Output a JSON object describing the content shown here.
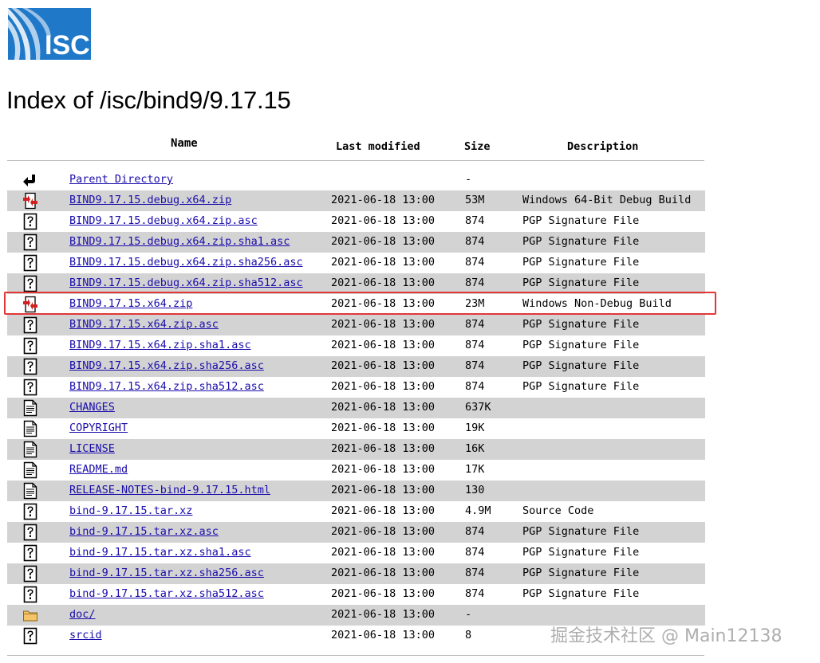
{
  "logo_text": "ISC",
  "page_title": "Index of /isc/bind9/9.17.15",
  "columns": {
    "name": "Name",
    "last_modified": "Last modified",
    "size": "Size",
    "description": "Description"
  },
  "rows": [
    {
      "icon": "back-icon",
      "name": "Parent Directory",
      "modified": "",
      "size": "-",
      "description": ""
    },
    {
      "icon": "binary-icon",
      "name": "BIND9.17.15.debug.x64.zip",
      "modified": "2021-06-18 13:00",
      "size": "53M",
      "description": "Windows 64-Bit Debug Build"
    },
    {
      "icon": "unknown-icon",
      "name": "BIND9.17.15.debug.x64.zip.asc",
      "modified": "2021-06-18 13:00",
      "size": "874",
      "description": "PGP Signature File"
    },
    {
      "icon": "unknown-icon",
      "name": "BIND9.17.15.debug.x64.zip.sha1.asc",
      "modified": "2021-06-18 13:00",
      "size": "874",
      "description": "PGP Signature File"
    },
    {
      "icon": "unknown-icon",
      "name": "BIND9.17.15.debug.x64.zip.sha256.asc",
      "modified": "2021-06-18 13:00",
      "size": "874",
      "description": "PGP Signature File"
    },
    {
      "icon": "unknown-icon",
      "name": "BIND9.17.15.debug.x64.zip.sha512.asc",
      "modified": "2021-06-18 13:00",
      "size": "874",
      "description": "PGP Signature File"
    },
    {
      "icon": "binary-icon",
      "name": "BIND9.17.15.x64.zip",
      "modified": "2021-06-18 13:00",
      "size": "23M",
      "description": "Windows Non-Debug Build",
      "highlighted": true
    },
    {
      "icon": "unknown-icon",
      "name": "BIND9.17.15.x64.zip.asc",
      "modified": "2021-06-18 13:00",
      "size": "874",
      "description": "PGP Signature File"
    },
    {
      "icon": "unknown-icon",
      "name": "BIND9.17.15.x64.zip.sha1.asc",
      "modified": "2021-06-18 13:00",
      "size": "874",
      "description": "PGP Signature File"
    },
    {
      "icon": "unknown-icon",
      "name": "BIND9.17.15.x64.zip.sha256.asc",
      "modified": "2021-06-18 13:00",
      "size": "874",
      "description": "PGP Signature File"
    },
    {
      "icon": "unknown-icon",
      "name": "BIND9.17.15.x64.zip.sha512.asc",
      "modified": "2021-06-18 13:00",
      "size": "874",
      "description": "PGP Signature File"
    },
    {
      "icon": "text-icon",
      "name": "CHANGES",
      "modified": "2021-06-18 13:00",
      "size": "637K",
      "description": ""
    },
    {
      "icon": "text-icon",
      "name": "COPYRIGHT",
      "modified": "2021-06-18 13:00",
      "size": "19K",
      "description": ""
    },
    {
      "icon": "text-icon",
      "name": "LICENSE",
      "modified": "2021-06-18 13:00",
      "size": "16K",
      "description": ""
    },
    {
      "icon": "text-icon",
      "name": "README.md",
      "modified": "2021-06-18 13:00",
      "size": "17K",
      "description": ""
    },
    {
      "icon": "text-icon",
      "name": "RELEASE-NOTES-bind-9.17.15.html",
      "modified": "2021-06-18 13:00",
      "size": "130",
      "description": ""
    },
    {
      "icon": "unknown-icon",
      "name": "bind-9.17.15.tar.xz",
      "modified": "2021-06-18 13:00",
      "size": "4.9M",
      "description": "Source Code"
    },
    {
      "icon": "unknown-icon",
      "name": "bind-9.17.15.tar.xz.asc",
      "modified": "2021-06-18 13:00",
      "size": "874",
      "description": "PGP Signature File"
    },
    {
      "icon": "unknown-icon",
      "name": "bind-9.17.15.tar.xz.sha1.asc",
      "modified": "2021-06-18 13:00",
      "size": "874",
      "description": "PGP Signature File"
    },
    {
      "icon": "unknown-icon",
      "name": "bind-9.17.15.tar.xz.sha256.asc",
      "modified": "2021-06-18 13:00",
      "size": "874",
      "description": "PGP Signature File"
    },
    {
      "icon": "unknown-icon",
      "name": "bind-9.17.15.tar.xz.sha512.asc",
      "modified": "2021-06-18 13:00",
      "size": "874",
      "description": "PGP Signature File"
    },
    {
      "icon": "folder-icon",
      "name": "doc/",
      "modified": "2021-06-18 13:00",
      "size": "-",
      "description": ""
    },
    {
      "icon": "unknown-icon",
      "name": "srcid",
      "modified": "2021-06-18 13:00",
      "size": "8",
      "description": ""
    }
  ],
  "watermark": "掘金技术社区 @ Main12138",
  "colors": {
    "link": "#1a0dab",
    "alt_row": "#d3d3d3",
    "highlight_border": "#e33737",
    "logo_blue": "#1f78c8"
  }
}
